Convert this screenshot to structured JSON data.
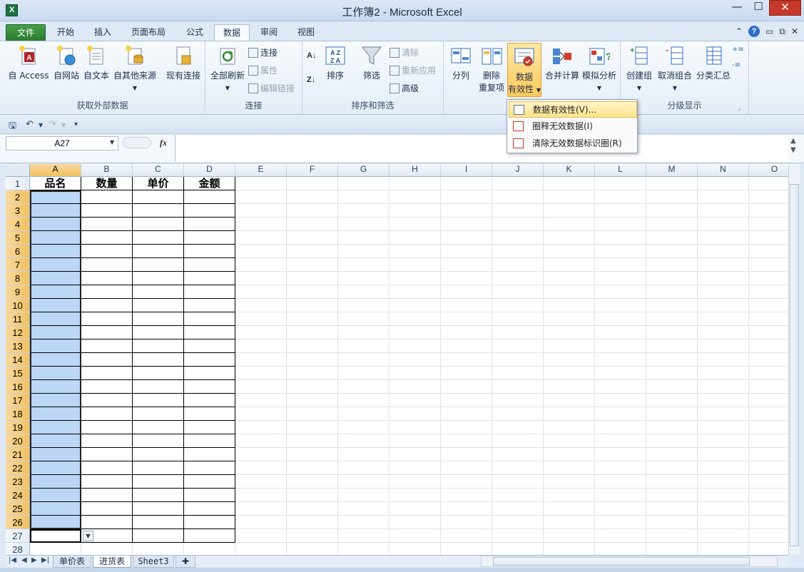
{
  "window": {
    "title": "工作簿2 - Microsoft Excel",
    "app_icon_label": "X",
    "controls": [
      "—",
      "☐",
      "✕"
    ]
  },
  "ribbon_tabs": [
    {
      "label": "文件",
      "kind": "file"
    },
    {
      "label": "开始"
    },
    {
      "label": "插入"
    },
    {
      "label": "页面布局"
    },
    {
      "label": "公式"
    },
    {
      "label": "数据",
      "kind": "active"
    },
    {
      "label": "审阅"
    },
    {
      "label": "视图"
    }
  ],
  "ribbon": {
    "external": {
      "label": "获取外部数据",
      "access": "自 Access",
      "web": "自网站",
      "text": "自文本",
      "other": "自其他来源",
      "existing": "现有连接"
    },
    "connections": {
      "label": "连接",
      "refresh_all": "全部刷新",
      "connections": "连接",
      "properties": "属性",
      "edit_links": "编辑链接"
    },
    "sort_filter": {
      "label": "排序和筛选",
      "sort": "排序",
      "filter": "筛选",
      "clear": "清除",
      "reapply": "重新应用",
      "advanced": "高级"
    },
    "tools": {
      "split": "分列",
      "remove_dup_1": "删除",
      "remove_dup_2": "重复项",
      "validation_1": "数据",
      "validation_2": "有效性",
      "consolidate": "合并计算",
      "whatif": "模拟分析"
    },
    "outline": {
      "label": "分级显示",
      "group": "创建组",
      "ungroup": "取消组合",
      "subtotal": "分类汇总"
    }
  },
  "dropdown_menu": [
    {
      "label": "数据有效性(V)...",
      "highlighted": true
    },
    {
      "label": "圈释无效数据(I)"
    },
    {
      "label": "清除无效数据标识圈(R)"
    }
  ],
  "formula_bar": {
    "name_box": "A27",
    "fx": "fx",
    "value": ""
  },
  "sheet": {
    "columns": [
      "A",
      "B",
      "C",
      "D",
      "E",
      "F",
      "G",
      "H",
      "I",
      "J",
      "K",
      "L",
      "M",
      "N",
      "O"
    ],
    "selected_column": "A",
    "rows": [
      "1",
      "2",
      "3",
      "4",
      "5",
      "6",
      "7",
      "8",
      "9",
      "10",
      "11",
      "12",
      "13",
      "14",
      "15",
      "16",
      "17",
      "18",
      "19",
      "20",
      "21",
      "22",
      "23",
      "24",
      "25",
      "26",
      "27",
      "28"
    ],
    "selected_rows": [
      "2",
      "3",
      "4",
      "5",
      "6",
      "7",
      "8",
      "9",
      "10",
      "11",
      "12",
      "13",
      "14",
      "15",
      "16",
      "17",
      "18",
      "19",
      "20",
      "21",
      "22",
      "23",
      "24",
      "25",
      "26"
    ],
    "headers": [
      "品名",
      "数量",
      "单价",
      "金额"
    ]
  },
  "sheet_tabs": [
    {
      "label": "单价表"
    },
    {
      "label": "进货表",
      "active": true
    },
    {
      "label": "Sheet3"
    }
  ]
}
